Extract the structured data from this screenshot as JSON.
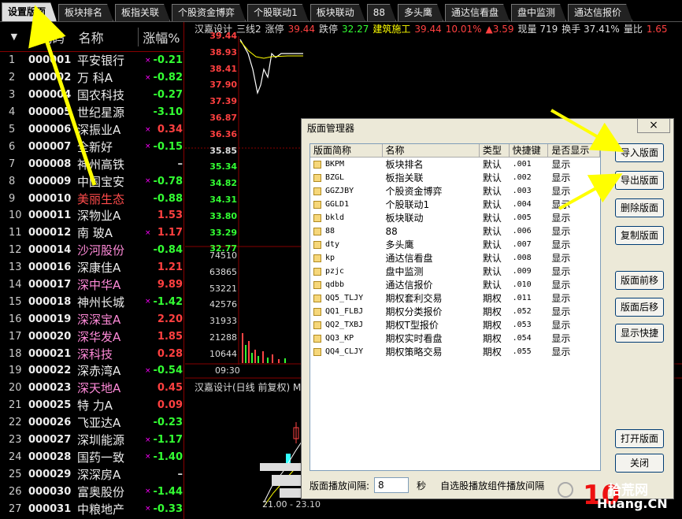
{
  "tabs": [
    {
      "label": "设置版面",
      "active": true
    },
    {
      "label": "板块排名"
    },
    {
      "label": "板指关联"
    },
    {
      "label": "个股资金博弈"
    },
    {
      "label": "个股联动1"
    },
    {
      "label": "板块联动"
    },
    {
      "label": "88"
    },
    {
      "label": "多头鹰"
    },
    {
      "label": "通达信看盘"
    },
    {
      "label": "盘中监测"
    },
    {
      "label": "通达信报价"
    }
  ],
  "stocklist": {
    "header": {
      "arrow": "▼",
      "code": "代码",
      "name": "名称",
      "change": "涨幅%"
    },
    "rows": [
      {
        "idx": "1",
        "code": "000001",
        "name": "平安银行",
        "change": "-0.21",
        "dir": "down",
        "mark": "×",
        "color": "white"
      },
      {
        "idx": "2",
        "code": "000002",
        "name": "万 科A",
        "change": "-0.82",
        "dir": "down",
        "mark": "×",
        "color": "white"
      },
      {
        "idx": "3",
        "code": "000004",
        "name": "国农科技",
        "change": "-0.27",
        "dir": "down",
        "mark": "",
        "color": "white"
      },
      {
        "idx": "4",
        "code": "000005",
        "name": "世纪星源",
        "change": "-3.10",
        "dir": "down",
        "mark": "",
        "color": "white"
      },
      {
        "idx": "5",
        "code": "000006",
        "name": "深振业A",
        "change": "0.34",
        "dir": "up",
        "mark": "×",
        "color": "white"
      },
      {
        "idx": "6",
        "code": "000007",
        "name": "全新好",
        "change": "-0.15",
        "dir": "down",
        "mark": "×",
        "color": "white"
      },
      {
        "idx": "7",
        "code": "000008",
        "name": "神州高铁",
        "change": "–",
        "dir": "flat",
        "mark": "",
        "color": "white"
      },
      {
        "idx": "8",
        "code": "000009",
        "name": "中国宝安",
        "change": "-0.78",
        "dir": "down",
        "mark": "×",
        "color": "white"
      },
      {
        "idx": "9",
        "code": "000010",
        "name": "美丽生态",
        "change": "-0.88",
        "dir": "down",
        "mark": "",
        "color": "red"
      },
      {
        "idx": "10",
        "code": "000011",
        "name": "深物业A",
        "change": "1.53",
        "dir": "up",
        "mark": "",
        "color": "white"
      },
      {
        "idx": "11",
        "code": "000012",
        "name": "南 玻A",
        "change": "1.17",
        "dir": "up",
        "mark": "×",
        "color": "white"
      },
      {
        "idx": "12",
        "code": "000014",
        "name": "沙河股份",
        "change": "-0.84",
        "dir": "down",
        "mark": "",
        "color": "pink"
      },
      {
        "idx": "13",
        "code": "000016",
        "name": "深康佳A",
        "change": "1.21",
        "dir": "up",
        "mark": "",
        "color": "white"
      },
      {
        "idx": "14",
        "code": "000017",
        "name": "深中华A",
        "change": "9.89",
        "dir": "up",
        "mark": "",
        "color": "pink"
      },
      {
        "idx": "15",
        "code": "000018",
        "name": "神州长城",
        "change": "-1.42",
        "dir": "down",
        "mark": "×",
        "color": "white"
      },
      {
        "idx": "16",
        "code": "000019",
        "name": "深深宝A",
        "change": "2.20",
        "dir": "up",
        "mark": "",
        "color": "pink"
      },
      {
        "idx": "17",
        "code": "000020",
        "name": "深华发A",
        "change": "1.85",
        "dir": "up",
        "mark": "",
        "color": "pink"
      },
      {
        "idx": "18",
        "code": "000021",
        "name": "深科技",
        "change": "0.28",
        "dir": "up",
        "mark": "",
        "color": "pink"
      },
      {
        "idx": "19",
        "code": "000022",
        "name": "深赤湾A",
        "change": "-0.54",
        "dir": "down",
        "mark": "×",
        "color": "white"
      },
      {
        "idx": "20",
        "code": "000023",
        "name": "深天地A",
        "change": "0.45",
        "dir": "up",
        "mark": "",
        "color": "pink"
      },
      {
        "idx": "21",
        "code": "000025",
        "name": "特 力A",
        "change": "0.09",
        "dir": "up",
        "mark": "",
        "color": "white"
      },
      {
        "idx": "22",
        "code": "000026",
        "name": "飞亚达A",
        "change": "-0.23",
        "dir": "down",
        "mark": "",
        "color": "white"
      },
      {
        "idx": "23",
        "code": "000027",
        "name": "深圳能源",
        "change": "-1.17",
        "dir": "down",
        "mark": "×",
        "color": "white"
      },
      {
        "idx": "24",
        "code": "000028",
        "name": "国药一致",
        "change": "-1.40",
        "dir": "down",
        "mark": "×",
        "color": "white"
      },
      {
        "idx": "25",
        "code": "000029",
        "name": "深深房A",
        "change": "–",
        "dir": "flat",
        "mark": "",
        "color": "white"
      },
      {
        "idx": "26",
        "code": "000030",
        "name": "富奥股份",
        "change": "-1.44",
        "dir": "down",
        "mark": "×",
        "color": "white"
      },
      {
        "idx": "27",
        "code": "000031",
        "name": "中粮地产",
        "change": "-0.33",
        "dir": "down",
        "mark": "×",
        "color": "white"
      }
    ]
  },
  "chart": {
    "info": [
      {
        "text": "汉嘉设计",
        "color": "#dddddd"
      },
      {
        "text": "三线2",
        "color": "#dddddd"
      },
      {
        "text": "涨停",
        "color": "#dddddd"
      },
      {
        "text": "39.44",
        "color": "#ff4040"
      },
      {
        "text": "跌停",
        "color": "#dddddd"
      },
      {
        "text": "32.27",
        "color": "#33ff33"
      },
      {
        "text": "建筑施工",
        "color": "#ffff00"
      },
      {
        "text": "39.44",
        "color": "#ff4040"
      },
      {
        "text": "10.01%",
        "color": "#ff4040"
      },
      {
        "text": "▲3.59",
        "color": "#ff4040"
      },
      {
        "text": "现量 719",
        "color": "#dddddd"
      },
      {
        "text": "换手 37.41%",
        "color": "#dddddd"
      },
      {
        "text": "量比",
        "color": "#dddddd"
      },
      {
        "text": "1.65",
        "color": "#ff4040"
      }
    ],
    "price_labels": [
      {
        "text": "39.44",
        "color": "#ff4040"
      },
      {
        "text": "38.93",
        "color": "#ff4040"
      },
      {
        "text": "38.41",
        "color": "#ff4040"
      },
      {
        "text": "37.90",
        "color": "#ff4040"
      },
      {
        "text": "37.39",
        "color": "#ff4040"
      },
      {
        "text": "36.87",
        "color": "#ff4040"
      },
      {
        "text": "36.36",
        "color": "#ff4040"
      },
      {
        "text": "35.85",
        "color": "#dddddd"
      },
      {
        "text": "35.34",
        "color": "#33ff33"
      },
      {
        "text": "34.82",
        "color": "#33ff33"
      },
      {
        "text": "34.31",
        "color": "#33ff33"
      },
      {
        "text": "33.80",
        "color": "#33ff33"
      },
      {
        "text": "33.29",
        "color": "#33ff33"
      },
      {
        "text": "32.77",
        "color": "#33ff33"
      }
    ],
    "volume_labels": [
      "74510",
      "63865",
      "53221",
      "42576",
      "31933",
      "21288",
      "10644"
    ],
    "time_label": "09:30",
    "kline_title": "汉嘉设计(日线 前复权) MA",
    "kline_range": "21.00 - 23.10"
  },
  "dialog": {
    "title": "版面管理器",
    "close": "×",
    "columns": [
      "版面简称",
      "名称",
      "类型",
      "快捷键",
      "是否显示"
    ],
    "rows": [
      {
        "short": "BKPM",
        "name": "板块排名",
        "type": "默认",
        "key": ".001",
        "show": "显示"
      },
      {
        "short": "BZGL",
        "name": "板指关联",
        "type": "默认",
        "key": ".002",
        "show": "显示"
      },
      {
        "short": "GGZJBY",
        "name": "个股资金博弈",
        "type": "默认",
        "key": ".003",
        "show": "显示"
      },
      {
        "short": "GGLD1",
        "name": "个股联动1",
        "type": "默认",
        "key": ".004",
        "show": "显示"
      },
      {
        "short": "bkld",
        "name": "板块联动",
        "type": "默认",
        "key": ".005",
        "show": "显示"
      },
      {
        "short": "88",
        "name": "88",
        "type": "默认",
        "key": ".006",
        "show": "显示"
      },
      {
        "short": "dty",
        "name": "多头鹰",
        "type": "默认",
        "key": ".007",
        "show": "显示"
      },
      {
        "short": "kp",
        "name": "通达信看盘",
        "type": "默认",
        "key": ".008",
        "show": "显示"
      },
      {
        "short": "pzjc",
        "name": "盘中监测",
        "type": "默认",
        "key": ".009",
        "show": "显示"
      },
      {
        "short": "qdbb",
        "name": "通达信报价",
        "type": "默认",
        "key": ".010",
        "show": "显示"
      },
      {
        "short": "QQ5_TLJY",
        "name": "期权套利交易",
        "type": "期权",
        "key": ".011",
        "show": "显示"
      },
      {
        "short": "QQ1_FLBJ",
        "name": "期权分类报价",
        "type": "期权",
        "key": ".052",
        "show": "显示"
      },
      {
        "short": "QQ2_TXBJ",
        "name": "期权T型报价",
        "type": "期权",
        "key": ".053",
        "show": "显示"
      },
      {
        "short": "QQ3_KP",
        "name": "期权实时看盘",
        "type": "期权",
        "key": ".054",
        "show": "显示"
      },
      {
        "short": "QQ4_CLJY",
        "name": "期权策略交易",
        "type": "期权",
        "key": ".055",
        "show": "显示"
      }
    ],
    "buttons": {
      "import": "导入版面",
      "export": "导出版面",
      "delete": "删除版面",
      "copy": "复制版面",
      "move_up": "版面前移",
      "move_down": "版面后移",
      "show_shortcut": "显示快捷",
      "open": "打开版面",
      "close": "关闭"
    },
    "interval_label": "版面播放间隔:",
    "interval_value": "8",
    "interval_unit": "秒",
    "auto_label": "自选股播放组件播放间隔"
  },
  "watermark": {
    "main": "10",
    "text1": "拾荒网",
    "text2": "Huang.CN"
  }
}
